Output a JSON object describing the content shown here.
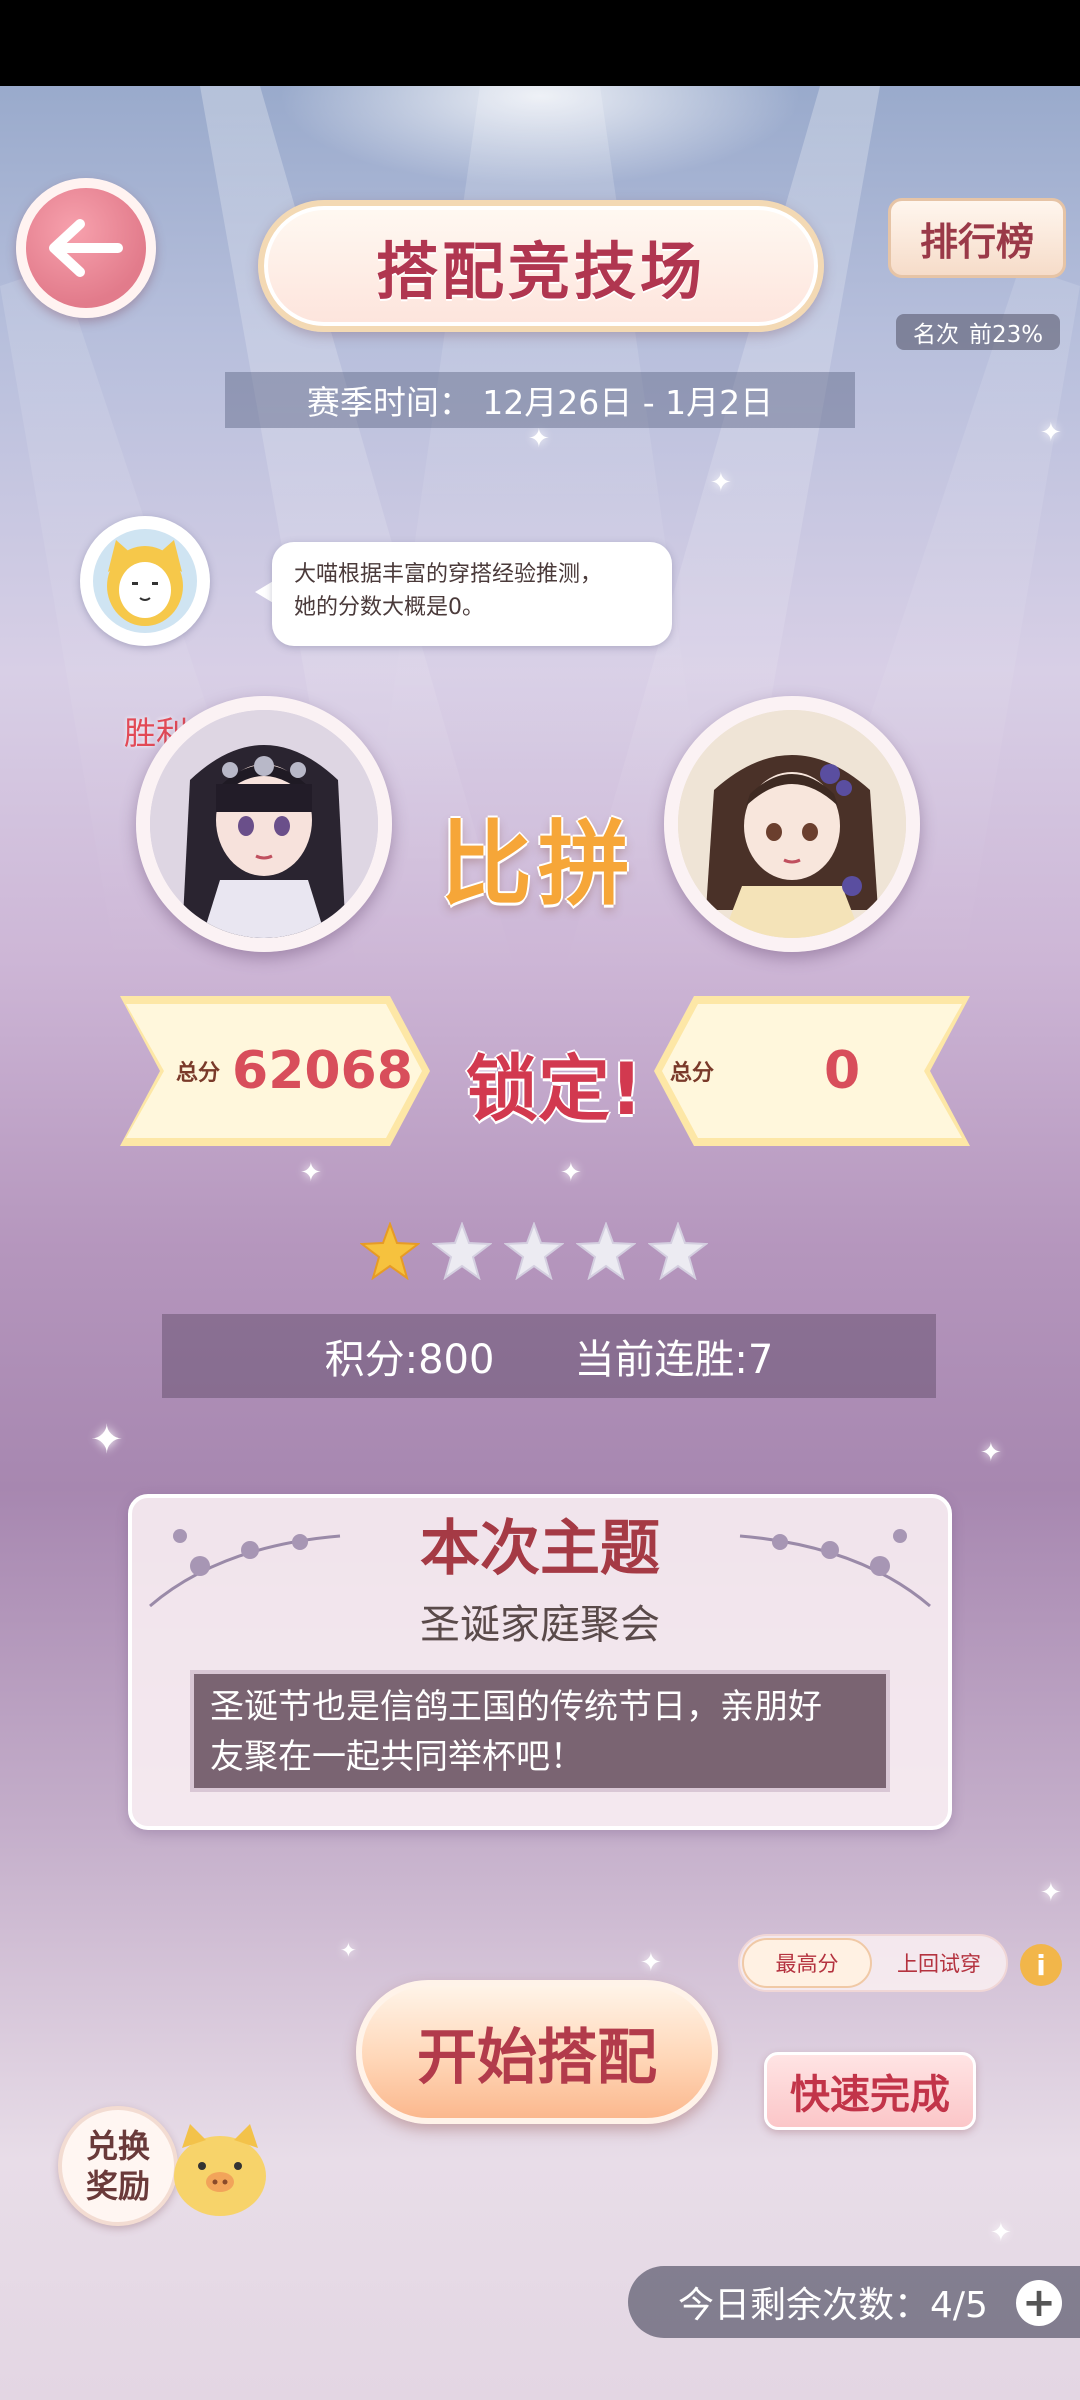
{
  "header": {
    "title": "搭配竞技场",
    "leaderboard_label": "排行榜",
    "rank_label": "名次",
    "rank_value": "前23%",
    "season": "赛季时间： 12月26日 - 1月2日"
  },
  "hint": {
    "text_line1": "大喵根据丰富的穿搭经验推测，",
    "text_line2": "她的分数大概是0。"
  },
  "battle": {
    "victory_label": "胜利",
    "vs_label": "比拼",
    "lock_label": "锁定!",
    "left": {
      "score_label": "总分",
      "score": "62068"
    },
    "right": {
      "score_label": "总分",
      "score": "0"
    },
    "stars_filled": 1,
    "stars_total": 5
  },
  "stats": {
    "points": "积分:800",
    "streak": "当前连胜:7"
  },
  "theme": {
    "heading": "本次主题",
    "name": "圣诞家庭聚会",
    "desc_line1": "圣诞节也是信鸽王国的传统节日，亲朋好",
    "desc_line2": "友聚在一起共同举杯吧！"
  },
  "controls": {
    "toggle_best": "最高分",
    "toggle_last": "上回试穿",
    "info": "i",
    "start": "开始搭配",
    "quick": "快速完成",
    "exchange_line1": "兑换",
    "exchange_line2": "奖励",
    "attempts": "今日剩余次数：4/5",
    "plus": "+"
  },
  "colors": {
    "accent_title": "#b03650",
    "accent_score": "#d84e5b",
    "vs_gold": "#f6a638"
  }
}
